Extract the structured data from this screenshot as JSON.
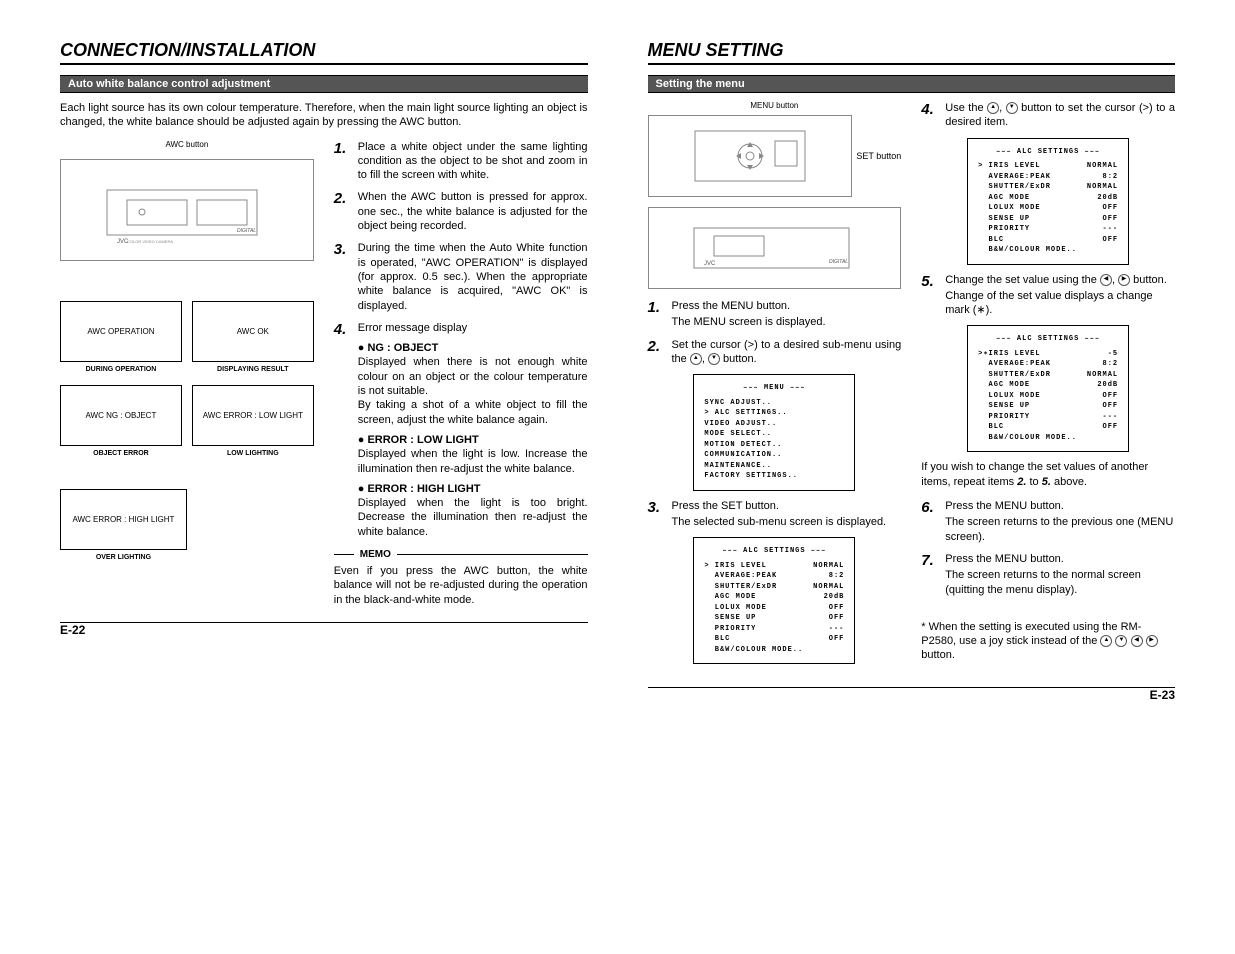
{
  "left": {
    "title": "CONNECTION/INSTALLATION",
    "subtitle": "Auto white balance control adjustment",
    "intro": "Each light source has its own colour temperature. Therefore, when the main light source lighting an object is changed, the white balance should be adjusted again by pressing the AWC button.",
    "awc_button_label": "AWC button",
    "boxes": {
      "op": "AWC   OPERATION",
      "ok": "AWC    OK",
      "op_cap": "DURING OPERATION",
      "ok_cap": "DISPLAYING RESULT",
      "ng": "AWC   NG : OBJECT",
      "low": "AWC   ERROR : LOW LIGHT",
      "ng_cap": "OBJECT ERROR",
      "low_cap": "LOW LIGHTING",
      "high": "AWC   ERROR : HIGH LIGHT",
      "high_cap": "OVER LIGHTING"
    },
    "steps": {
      "s1": "Place a white object under the same lighting condition as the object to be shot and zoom in to fill the screen with white.",
      "s2": "When the AWC button is pressed for approx. one sec., the white balance is adjusted for the object being recorded.",
      "s3": "During the time when the Auto White function is operated, \"AWC OPERATION\" is displayed (for approx. 0.5 sec.). When the appropriate white balance is acquired, \"AWC OK\" is displayed.",
      "s4_lead": "Error message display",
      "s4_b1_t": "NG : OBJECT",
      "s4_b1": "Displayed when there is not enough white colour on an object or the colour temperature is not suitable.",
      "s4_b1b": "By taking a shot of a white object to fill the screen, adjust the white balance again.",
      "s4_b2_t": "ERROR : LOW LIGHT",
      "s4_b2": "Displayed when the light is low. Increase the illumination then re-adjust the white balance.",
      "s4_b3_t": "ERROR : HIGH LIGHT",
      "s4_b3": "Displayed when the light is too bright. Decrease the illumination then re-adjust the white balance."
    },
    "memo_label": "MEMO",
    "memo": "Even if you press the AWC button, the white balance will not be re-adjusted during the operation in the black-and-white mode.",
    "page_num": "E-22"
  },
  "right": {
    "title": "MENU SETTING",
    "subtitle": "Setting the menu",
    "menu_button_label": "MENU button",
    "set_button_label": "SET button",
    "steps": {
      "s1a": "Press the MENU button.",
      "s1b": "The MENU screen is displayed.",
      "s2a": "Set the cursor (>) to a desired sub-menu using the ",
      "s2b": " button.",
      "s3a": "Press the SET button.",
      "s3b": "The selected sub-menu screen is displayed.",
      "s4a": "Use the ",
      "s4b": " button to set the cursor (>) to a desired item.",
      "s5a": "Change the set value using the ",
      "s5b": " button.",
      "s5c": "Change of the set value displays a change mark (∗).",
      "s5_note_a": "If you wish to change the set values of another items, repeat items ",
      "s5_note_b": " to ",
      "s5_note_c": " above.",
      "s6a": "Press the MENU button.",
      "s6b": "The screen returns to the previous one (MENU screen).",
      "s7a": "Press the MENU button.",
      "s7b": "The screen returns to the normal screen (quitting the menu display).",
      "footnote": "* When the setting is executed using the RM-P2580, use a joy stick instead of the "
    },
    "menus": {
      "main_title": "––– MENU –––",
      "main_items": [
        "  SYNC ADJUST..",
        "> ALC SETTINGS..",
        "  VIDEO ADJUST..",
        "  MODE SELECT..",
        "  MOTION DETECT..",
        "  COMMUNICATION..",
        "  MAINTENANCE..",
        "  FACTORY SETTINGS.."
      ],
      "alc_title": "––– ALC SETTINGS –––",
      "alc_rows": [
        [
          "> IRIS LEVEL",
          "NORMAL"
        ],
        [
          "  AVERAGE:PEAK",
          "8:2"
        ],
        [
          "  SHUTTER/ExDR",
          "NORMAL"
        ],
        [
          "  AGC MODE",
          "20dB"
        ],
        [
          "  LOLUX MODE",
          "OFF"
        ],
        [
          "  SENSE UP",
          "OFF"
        ],
        [
          "  PRIORITY",
          "---"
        ],
        [
          "  BLC",
          "OFF"
        ],
        [
          "  B&W/COLOUR MODE..",
          ""
        ]
      ],
      "alc_rows2": [
        [
          ">∗IRIS LEVEL",
          "-5"
        ],
        [
          "  AVERAGE:PEAK",
          "8:2"
        ],
        [
          "  SHUTTER/ExDR",
          "NORMAL"
        ],
        [
          "  AGC MODE",
          "20dB"
        ],
        [
          "  LOLUX MODE",
          "OFF"
        ],
        [
          "  SENSE UP",
          "OFF"
        ],
        [
          "  PRIORITY",
          "---"
        ],
        [
          "  BLC",
          "OFF"
        ],
        [
          "  B&W/COLOUR MODE..",
          ""
        ]
      ]
    },
    "page_num": "E-23"
  },
  "nums": {
    "n1": "1.",
    "n2": "2.",
    "n3": "3.",
    "n4": "4.",
    "n5": "5.",
    "n6": "6.",
    "n7": "7.",
    "i2": "2.",
    "i5": "5."
  }
}
